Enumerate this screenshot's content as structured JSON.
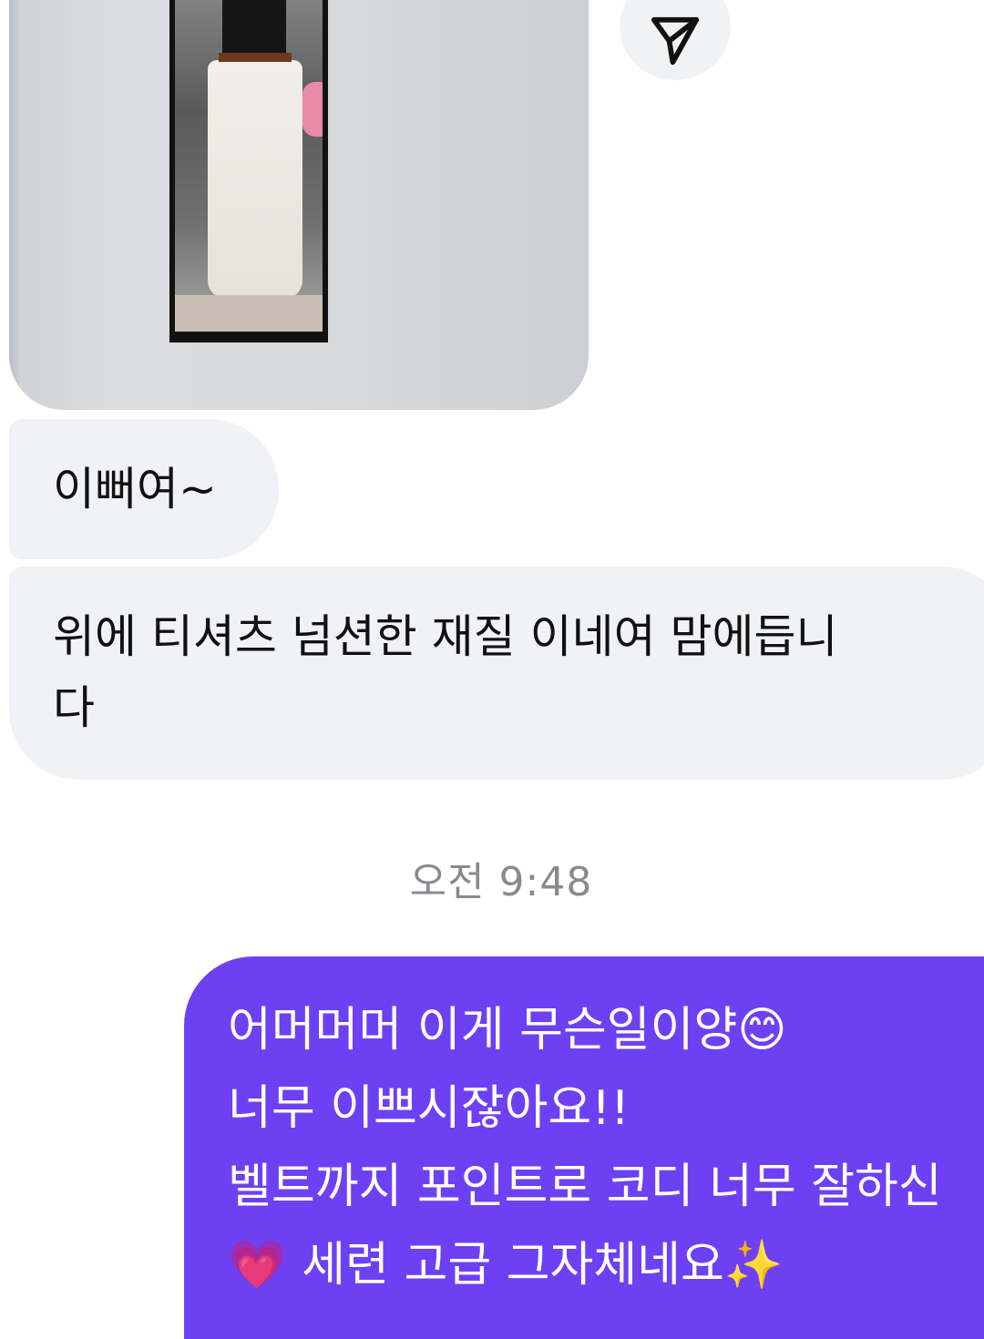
{
  "thread": {
    "photo_message": {
      "alt": "mirror selfie photo"
    },
    "reply_button_icon": "send-arrow-icon",
    "incoming_messages": [
      {
        "text": "이뻐여~"
      },
      {
        "text": "위에 티셔츠 넘션한 재질 이네여 맘에듭니\n다"
      }
    ],
    "timestamp": "오전 9:48",
    "outgoing_message": {
      "text": "어머머머 이게 무슨일이양😊\n너무 이쁘시잖아요!!\n벨트까지 포인트로 코디 너무 잘하신\n💗 세련 고급 그자체네요✨"
    }
  },
  "colors": {
    "incoming_bubble": "#f0f2f5",
    "outgoing_bubble": "#6d41f3",
    "timestamp": "#888a8e"
  }
}
